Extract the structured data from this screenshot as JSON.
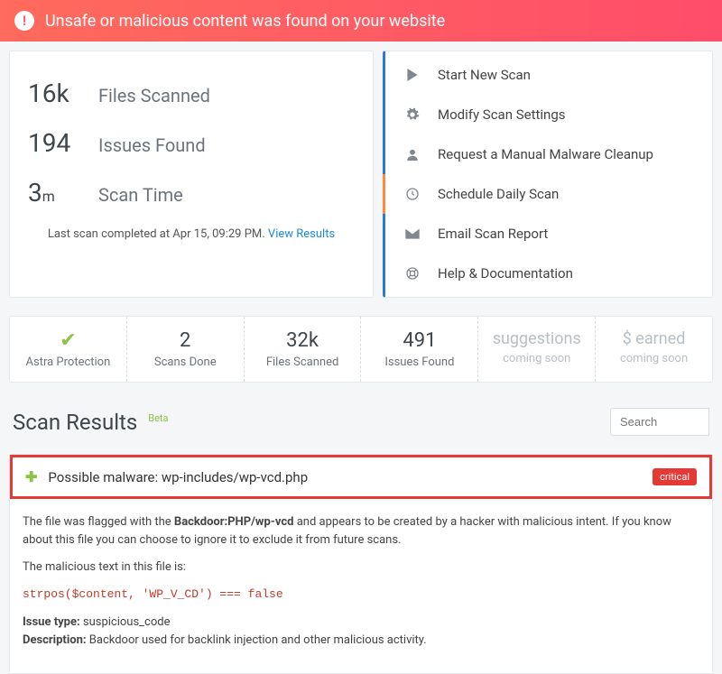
{
  "alert": {
    "message": "Unsafe or malicious content was found on your website"
  },
  "stats": {
    "files_scanned": {
      "value": "16k",
      "label": "Files Scanned"
    },
    "issues_found": {
      "value": "194",
      "label": "Issues Found"
    },
    "scan_time": {
      "value": "3",
      "unit": "m",
      "label": "Scan Time"
    },
    "last_scan_prefix": "Last scan completed at Apr 15, 09:29 PM. ",
    "view_results": "View Results"
  },
  "actions": {
    "start": "Start New Scan",
    "modify": "Modify Scan Settings",
    "request": "Request a Manual Malware Cleanup",
    "schedule": "Schedule Daily Scan",
    "email": "Email Scan Report",
    "help": "Help & Documentation"
  },
  "summary": {
    "protection": {
      "label": "Astra Protection"
    },
    "scans_done": {
      "value": "2",
      "label": "Scans Done"
    },
    "files": {
      "value": "32k",
      "label": "Files Scanned"
    },
    "issues": {
      "value": "491",
      "label": "Issues Found"
    },
    "suggestions": {
      "value": "suggestions",
      "label": "coming soon"
    },
    "earned": {
      "value": "$ earned",
      "label": "coming soon"
    }
  },
  "results": {
    "heading": "Scan Results",
    "beta": "Beta",
    "search_placeholder": "Search",
    "item": {
      "title": "Possible malware: wp-includes/wp-vcd.php",
      "badge": "critical",
      "desc1_a": "The file was flagged with the ",
      "desc1_b": "Backdoor:PHP/wp-vcd",
      "desc1_c": " and appears to be created by a hacker with malicious intent. If you know about this file you can choose to ignore it to exclude it from future scans.",
      "desc2": "The malicious text in this file is:",
      "code": "strpos($content, 'WP_V_CD') === false",
      "issue_type_label": "Issue type:",
      "issue_type": " suspicious_code",
      "desc_label": "Description:",
      "desc_text": " Backdoor used for backlink injection and other malicious activity."
    }
  }
}
